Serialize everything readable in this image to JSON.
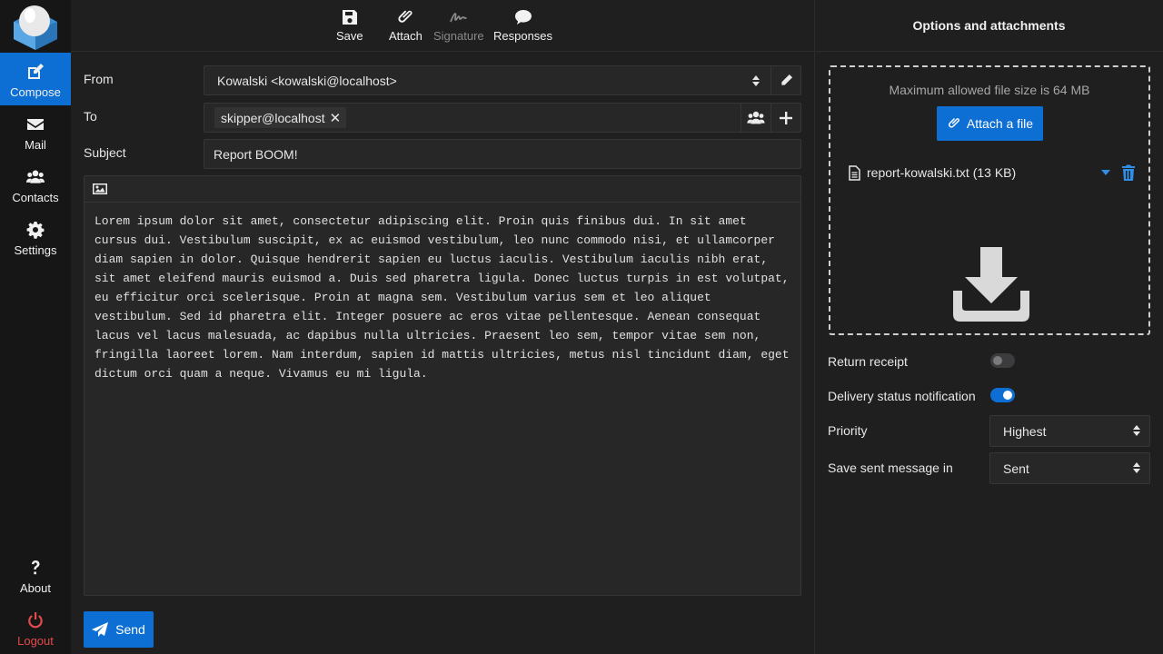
{
  "nav": {
    "items": [
      {
        "label": "Compose"
      },
      {
        "label": "Mail"
      },
      {
        "label": "Contacts"
      },
      {
        "label": "Settings"
      },
      {
        "label": "About"
      },
      {
        "label": "Logout"
      }
    ]
  },
  "toolbar": {
    "save": "Save",
    "attach": "Attach",
    "signature": "Signature",
    "responses": "Responses"
  },
  "compose": {
    "from_label": "From",
    "from_value": "Kowalski <kowalski@localhost>",
    "to_label": "To",
    "to_recipient": "skipper@localhost",
    "subject_label": "Subject",
    "subject_value": "Report BOOM!",
    "body": "Lorem ipsum dolor sit amet, consectetur adipiscing elit. Proin quis finibus dui. In sit amet cursus dui. Vestibulum suscipit, ex ac euismod vestibulum, leo nunc commodo nisi, et ullamcorper diam sapien in dolor. Quisque hendrerit sapien eu luctus iaculis. Vestibulum iaculis nibh erat, sit amet eleifend mauris euismod a. Duis sed pharetra ligula. Donec luctus turpis in est volutpat, eu efficitur orci scelerisque. Proin at magna sem. Vestibulum varius sem et leo aliquet vestibulum. Sed id pharetra elit. Integer posuere ac eros vitae pellentesque. Aenean consequat lacus vel lacus malesuada, ac dapibus nulla ultricies. Praesent leo sem, tempor vitae sem non, fringilla laoreet lorem. Nam interdum, sapien id mattis ultricies, metus nisl tincidunt diam, eget dictum orci quam a neque. Vivamus eu mi ligula.",
    "send": "Send"
  },
  "panel": {
    "title": "Options and attachments",
    "max_size_hint": "Maximum allowed file size is 64 MB",
    "attach_button": "Attach a file",
    "attachment_name": "report-kowalski.txt (13 KB)",
    "return_receipt_label": "Return receipt",
    "return_receipt_on": false,
    "dsn_label": "Delivery status notification",
    "dsn_on": true,
    "priority_label": "Priority",
    "priority_value": "Highest",
    "save_sent_label": "Save sent message in",
    "save_sent_value": "Sent"
  },
  "colors": {
    "accent": "#0d6fd3",
    "logout": "#e24a4a",
    "background": "#1f1f20",
    "nav": "#161617"
  }
}
